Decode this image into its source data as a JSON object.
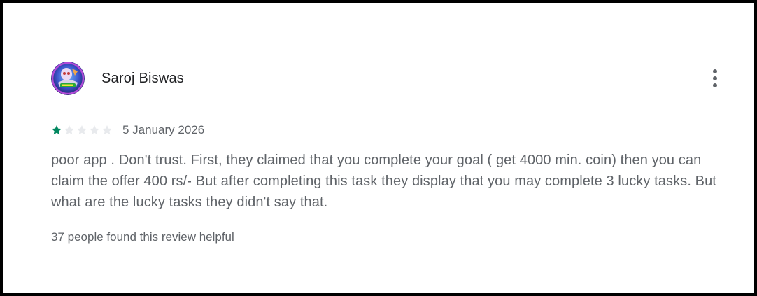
{
  "review": {
    "author": "Saroj Biswas",
    "avatar_icon": "user-avatar",
    "menu_icon": "more-vert-icon",
    "rating": 1,
    "rating_max": 5,
    "date": "5 January 2026",
    "text": "poor app . Don't trust. First, they claimed that you complete your goal ( get 4000 min. coin) then you can claim the offer 400 rs/- But after completing this task they display that you may complete 3 lucky tasks. But what are the lucky tasks they didn't say that.",
    "helpful": "37 people found this review helpful"
  },
  "colors": {
    "star_filled": "#01875f",
    "star_empty": "#e8eaed",
    "text_secondary": "#5f6368",
    "text_primary": "#202124",
    "frame_border": "#000000"
  }
}
